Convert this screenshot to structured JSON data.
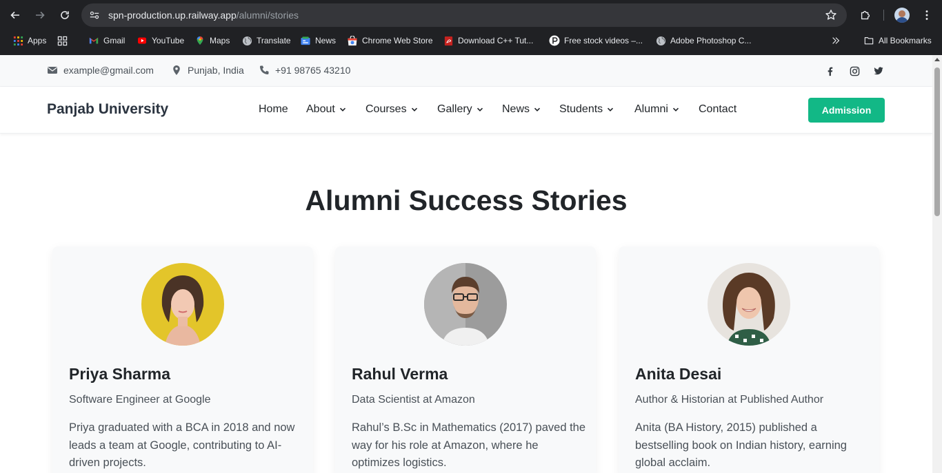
{
  "browser": {
    "url_host": "spn-production.up.railway.app",
    "url_path": "/alumni/stories",
    "bookmarks": [
      {
        "label": "Apps",
        "icon": "apps-grid-icon"
      },
      {
        "label": "Gmail",
        "icon": "gmail-icon"
      },
      {
        "label": "YouTube",
        "icon": "youtube-icon"
      },
      {
        "label": "Maps",
        "icon": "maps-pin-icon"
      },
      {
        "label": "Translate",
        "icon": "globe-icon"
      },
      {
        "label": "News",
        "icon": "google-news-icon"
      },
      {
        "label": "Chrome Web Store",
        "icon": "web-store-icon"
      },
      {
        "label": "Download C++ Tut...",
        "icon": "pdf-icon"
      },
      {
        "label": "Free stock videos –...",
        "icon": "pexels-icon"
      },
      {
        "label": "Adobe Photoshop C...",
        "icon": "globe-icon"
      }
    ],
    "all_bookmarks_label": "All Bookmarks"
  },
  "topbar": {
    "email": "example@gmail.com",
    "location": "Punjab, India",
    "phone": "+91 98765 43210",
    "social": [
      "facebook-icon",
      "instagram-icon",
      "twitter-icon"
    ]
  },
  "navbar": {
    "brand": "Panjab University",
    "menu": [
      {
        "label": "Home",
        "dropdown": false
      },
      {
        "label": "About",
        "dropdown": true
      },
      {
        "label": "Courses",
        "dropdown": true
      },
      {
        "label": "Gallery",
        "dropdown": true
      },
      {
        "label": "News",
        "dropdown": true
      },
      {
        "label": "Students",
        "dropdown": true
      },
      {
        "label": "Alumni",
        "dropdown": true
      },
      {
        "label": "Contact",
        "dropdown": false
      }
    ],
    "cta": "Admission",
    "cta_color": "#12b886"
  },
  "main": {
    "title": "Alumni Success Stories",
    "stories": [
      {
        "name": "Priya Sharma",
        "role": "Software Engineer at Google",
        "story": "Priya graduated with a BCA in 2018 and now leads a team at Google, contributing to AI-driven projects."
      },
      {
        "name": "Rahul Verma",
        "role": "Data Scientist at Amazon",
        "story": "Rahul’s B.Sc in Mathematics (2017) paved the way for his role at Amazon, where he optimizes logistics."
      },
      {
        "name": "Anita Desai",
        "role": "Author & Historian at Published Author",
        "story": "Anita (BA History, 2015) published a bestselling book on Indian history, earning global acclaim."
      }
    ]
  }
}
